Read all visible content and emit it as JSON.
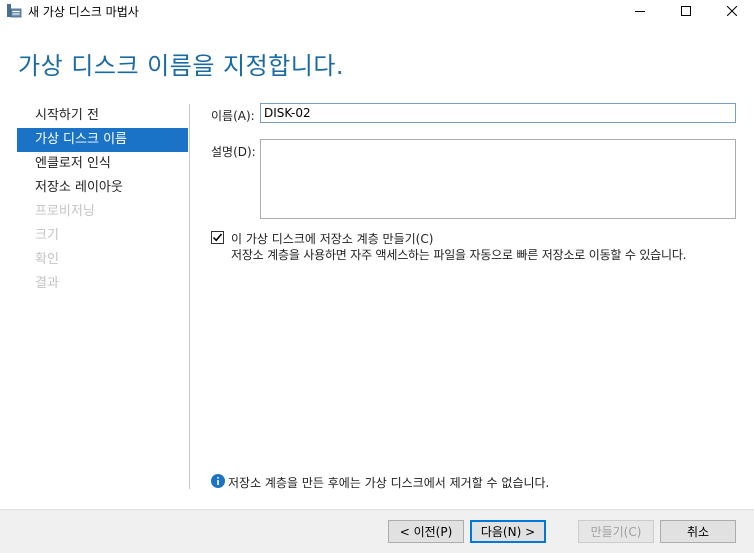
{
  "window": {
    "title": "새 가상 디스크 마법사",
    "minimize_glyph": "minimize-icon",
    "maximize_glyph": "maximize-icon",
    "close_glyph": "close-icon"
  },
  "page_title": "가상 디스크 이름을 지정합니다.",
  "steps": [
    {
      "label": "시작하기 전",
      "state": "normal"
    },
    {
      "label": "가상 디스크 이름",
      "state": "active"
    },
    {
      "label": "엔클로저 인식",
      "state": "normal"
    },
    {
      "label": "저장소 레이아웃",
      "state": "normal"
    },
    {
      "label": "프로비저닝",
      "state": "disabled"
    },
    {
      "label": "크기",
      "state": "disabled"
    },
    {
      "label": "확인",
      "state": "disabled"
    },
    {
      "label": "결과",
      "state": "disabled"
    }
  ],
  "form": {
    "name_label": "이름(A):",
    "name_value": "DISK-02",
    "desc_label": "설명(D):",
    "desc_value": "",
    "tier_checkbox_checked": true,
    "tier_checkbox_label": "이 가상 디스크에 저장소 계층 만들기(C)",
    "tier_description": "저장소 계층을 사용하면 자주 액세스하는 파일을 자동으로 빠른 저장소로 이동할 수 있습니다."
  },
  "info": {
    "icon": "info-icon",
    "text": "저장소 계층을 만든 후에는 가상 디스크에서 제거할 수 없습니다."
  },
  "buttons": {
    "prev": "< 이전(P)",
    "next": "다음(N) >",
    "create": "만들기(C)",
    "cancel": "취소"
  },
  "colors": {
    "accent": "#1a73c7",
    "title": "#1a6aa3",
    "info_icon": "#1a73c7"
  }
}
